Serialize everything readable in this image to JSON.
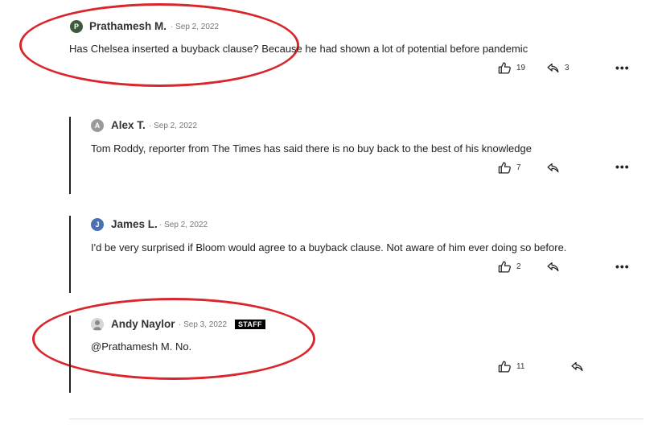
{
  "comments": [
    {
      "initial": "P",
      "avatar_color": "#3d5a3c",
      "author": "Prathamesh M.",
      "date": "· Sep 2, 2022",
      "text": "Has Chelsea inserted a buyback clause? Because he had shown a lot of potential before pandemic",
      "likes": "19",
      "replies": "3"
    },
    {
      "initial": "A",
      "avatar_color": "#9a9a9a",
      "author": "Alex T.",
      "date": "· Sep 2, 2022",
      "text": "Tom Roddy, reporter from The Times has said there is no buy back to the best of his knowledge",
      "likes": "7"
    },
    {
      "initial": "J",
      "avatar_color": "#4a6fb3",
      "author": "James L.",
      "date": "· Sep 2, 2022",
      "text": "I'd be very surprised if Bloom would agree to a buyback clause. Not aware of him ever doing so before.",
      "likes": "2"
    },
    {
      "initial": "",
      "avatar_color": "#bdbdbd",
      "author": "Andy Naylor",
      "date": "· Sep 3, 2022",
      "badge": "STAFF",
      "text": "@Prathamesh M. No.",
      "likes": "11"
    }
  ],
  "more_label": "•••",
  "colors": {
    "annotation": "#d9262c"
  }
}
